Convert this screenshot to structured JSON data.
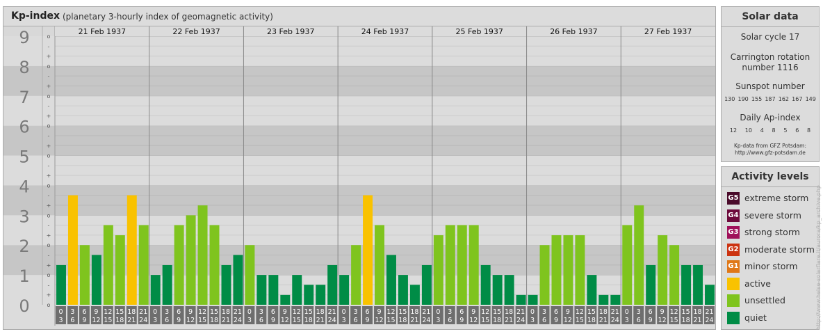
{
  "header": {
    "title": "Kp-index",
    "subtitle": "(planetary 3-hourly index of geomagnetic activity)"
  },
  "colors": {
    "quiet": "#008c46",
    "unsettled": "#7fc41e",
    "active": "#f9c200",
    "extreme": "#4a0a2a",
    "severe": "#6e0a3c",
    "strong": "#a0105a",
    "moderate": "#cc3311",
    "minor": "#e07818"
  },
  "chart_data": {
    "type": "bar",
    "y_axis": {
      "range": [
        0,
        9
      ],
      "major_labels": [
        "0",
        "1",
        "2",
        "3",
        "4",
        "5",
        "6",
        "7",
        "8",
        "9"
      ],
      "minor_marks": [
        "o",
        "+",
        "-",
        "o"
      ]
    },
    "days": [
      {
        "date": "21 Feb 1937",
        "kp": [
          1.33,
          3.67,
          2.0,
          1.67,
          2.67,
          2.33,
          3.67,
          2.67
        ]
      },
      {
        "date": "22 Feb 1937",
        "kp": [
          1.0,
          1.33,
          2.67,
          3.0,
          3.33,
          2.67,
          1.33,
          1.67
        ]
      },
      {
        "date": "23 Feb 1937",
        "kp": [
          2.0,
          1.0,
          1.0,
          0.33,
          1.0,
          0.67,
          0.67,
          1.33
        ]
      },
      {
        "date": "24 Feb 1937",
        "kp": [
          1.0,
          2.0,
          3.67,
          2.67,
          1.67,
          1.0,
          0.67,
          1.33
        ]
      },
      {
        "date": "25 Feb 1937",
        "kp": [
          2.33,
          2.67,
          2.67,
          2.67,
          1.33,
          1.0,
          1.0,
          0.33
        ]
      },
      {
        "date": "26 Feb 1937",
        "kp": [
          0.33,
          2.0,
          2.33,
          2.33,
          2.33,
          1.0,
          0.33,
          0.33
        ]
      },
      {
        "date": "27 Feb 1937",
        "kp": [
          2.67,
          3.33,
          1.33,
          2.33,
          2.0,
          1.33,
          1.33,
          0.67
        ]
      }
    ],
    "hour_slots": [
      [
        "0",
        "3"
      ],
      [
        "3",
        "6"
      ],
      [
        "6",
        "9"
      ],
      [
        "9",
        "12"
      ],
      [
        "12",
        "15"
      ],
      [
        "15",
        "18"
      ],
      [
        "18",
        "21"
      ],
      [
        "21",
        "24"
      ]
    ],
    "thresholds": {
      "unsettled_min": 2.0,
      "active_min": 3.67
    }
  },
  "solar": {
    "title": "Solar data",
    "cycle": "Solar cycle 17",
    "carrington_line1": "Carrington rotation",
    "carrington_line2": "number 1116",
    "sunspot_title": "Sunspot number",
    "sunspot_values": [
      "130",
      "190",
      "155",
      "187",
      "162",
      "167",
      "149"
    ],
    "ap_title": "Daily Ap-index",
    "ap_values": [
      "12",
      "10",
      "4",
      "8",
      "5",
      "6",
      "8"
    ],
    "source_line1": "Kp-data from GFZ Potsdam:",
    "source_line2": "http://www.gfz-potsdam.de"
  },
  "activity": {
    "title": "Activity levels",
    "items": [
      {
        "code": "G5",
        "label": "extreme storm",
        "color": "#4a0a2a"
      },
      {
        "code": "G4",
        "label": "severe storm",
        "color": "#6e0a3c"
      },
      {
        "code": "G3",
        "label": "strong storm",
        "color": "#a0105a"
      },
      {
        "code": "G2",
        "label": "moderate storm",
        "color": "#cc3311"
      },
      {
        "code": "G1",
        "label": "minor storm",
        "color": "#e07818"
      },
      {
        "code": "",
        "label": "active",
        "color": "#f9c200"
      },
      {
        "code": "",
        "label": "unsettled",
        "color": "#7fc41e"
      },
      {
        "code": "",
        "label": "quiet",
        "color": "#008c46"
      }
    ]
  },
  "watermark": "http://www.heise-solarflare.it/aurora/kp_archive.php"
}
